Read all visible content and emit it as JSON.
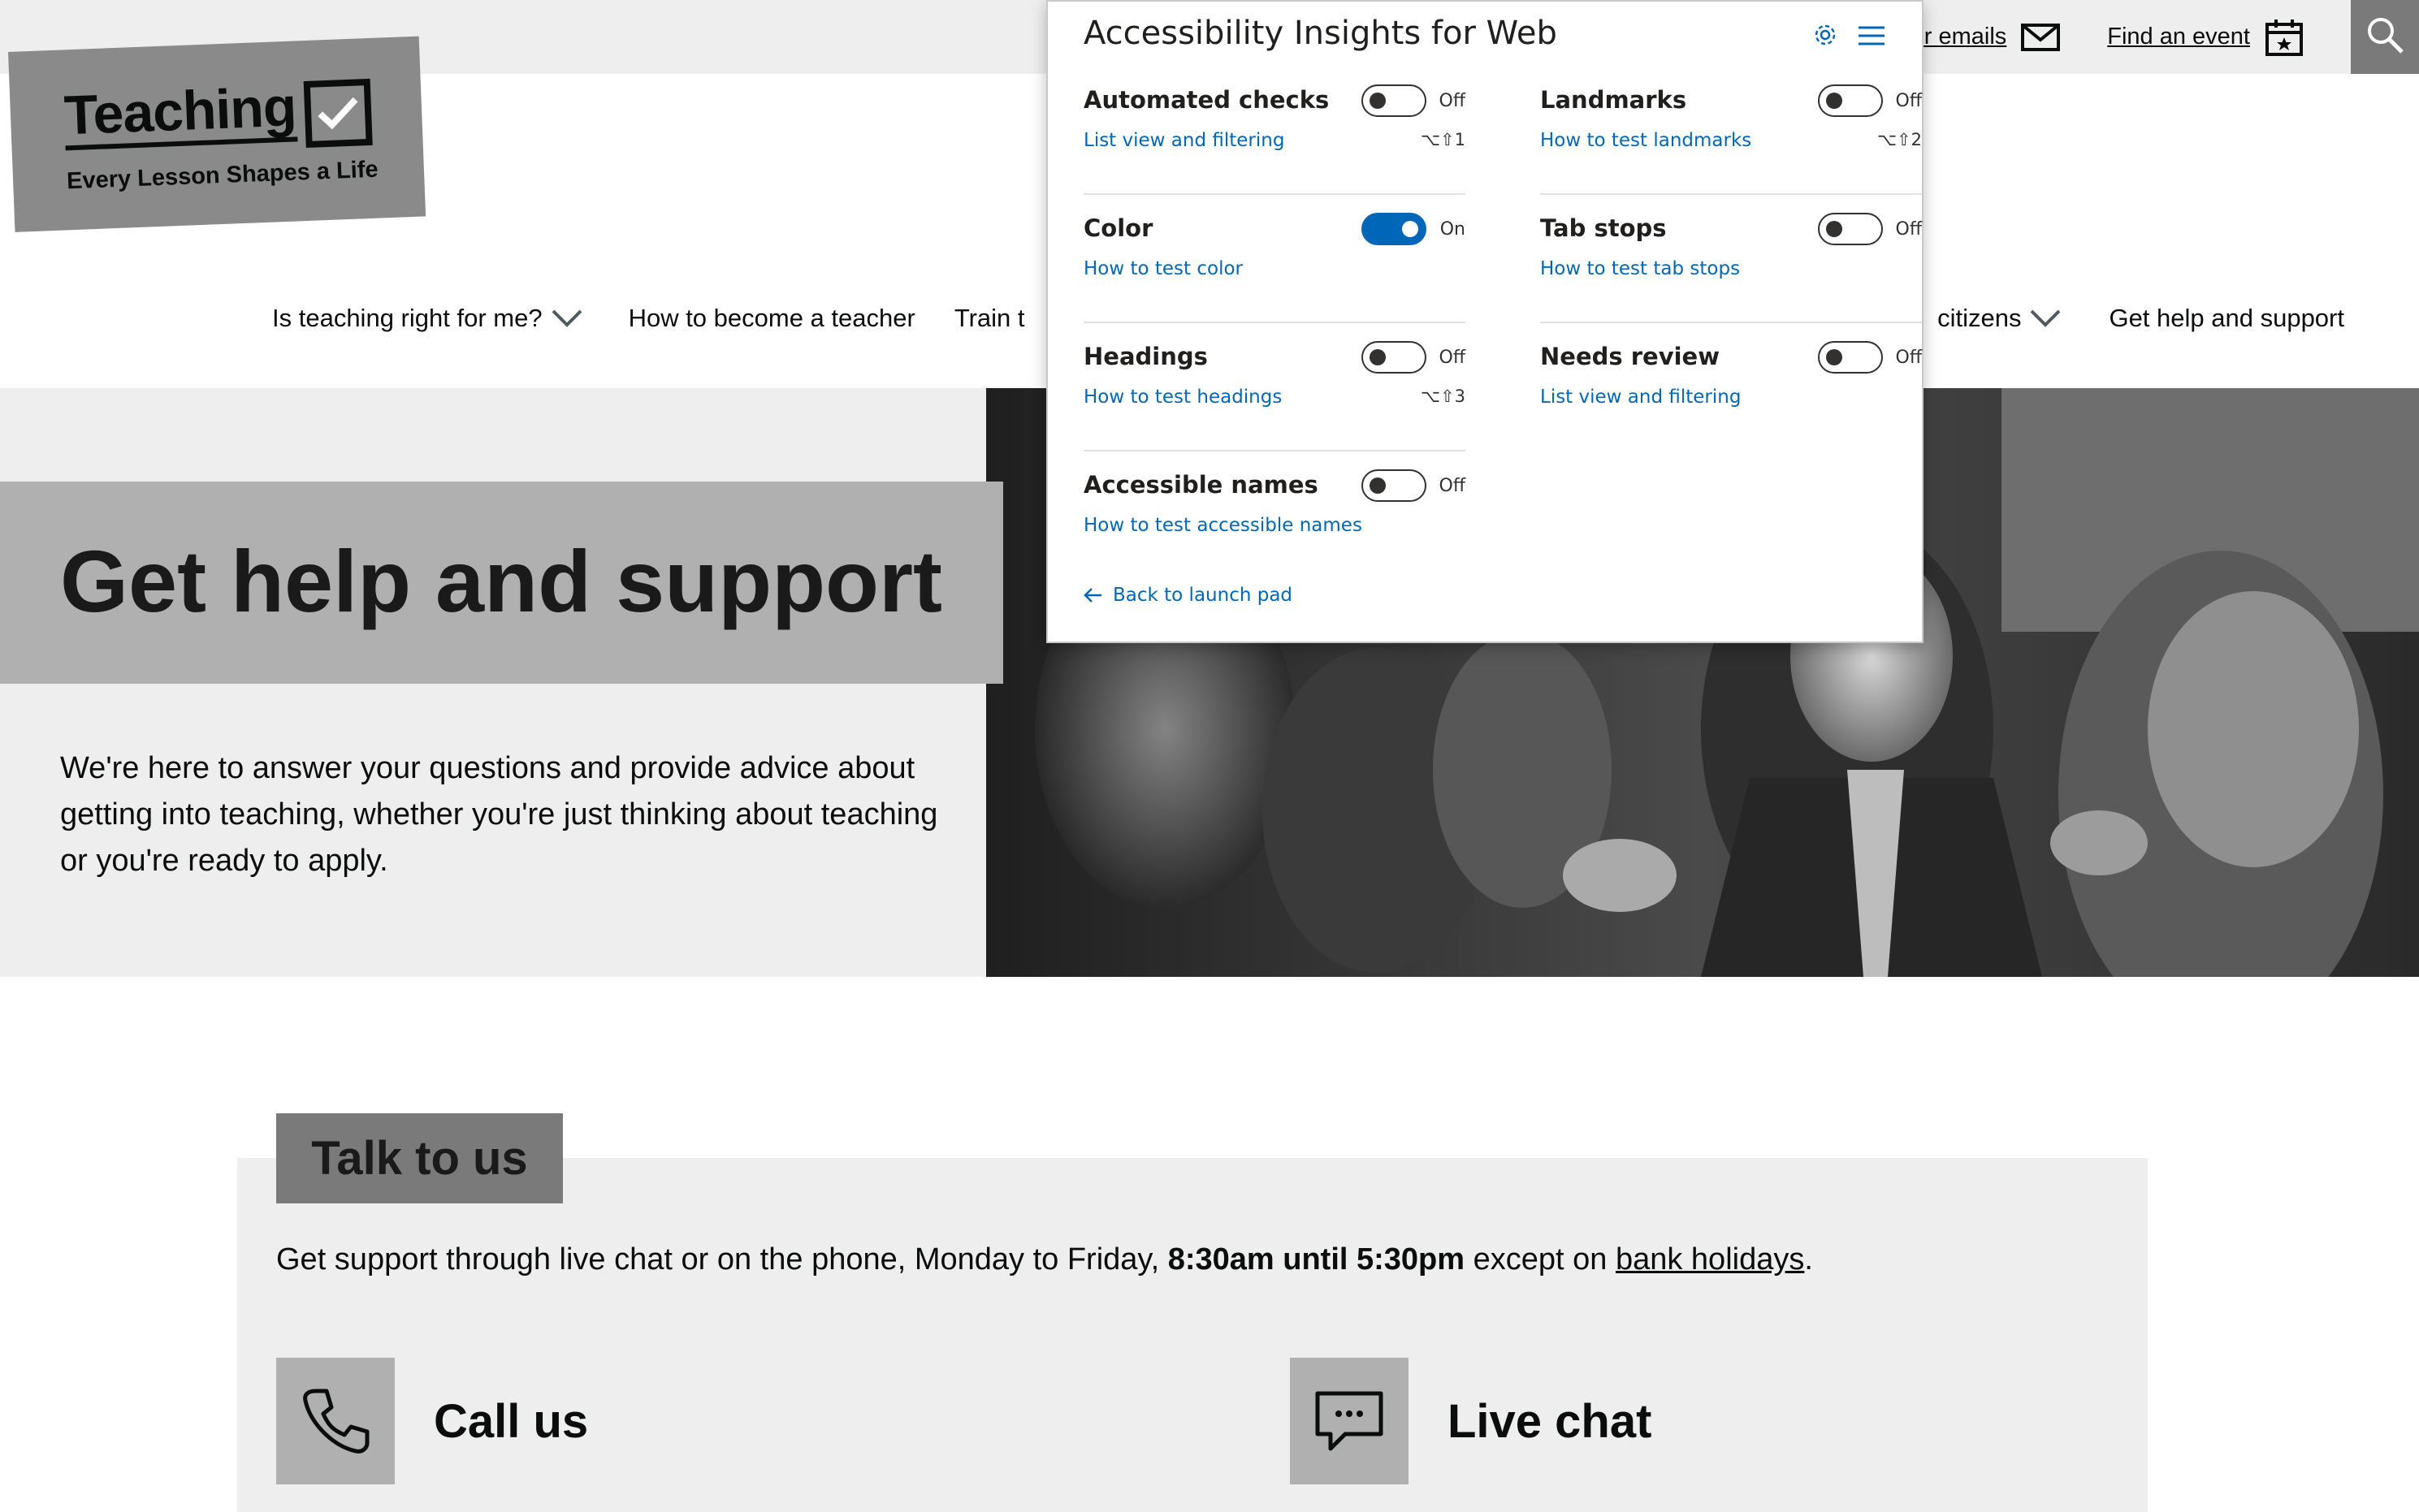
{
  "header": {
    "top_links": [
      {
        "label": "for emails",
        "icon": "envelope-icon"
      },
      {
        "label": "Find an event",
        "icon": "calendar-icon"
      }
    ],
    "search_icon": "search-icon",
    "logo": {
      "word": "Teaching",
      "tagline": "Every Lesson Shapes a Life"
    }
  },
  "nav": {
    "items": [
      {
        "label": "Is teaching right for me?",
        "has_dropdown": true
      },
      {
        "label": "How to become a teacher",
        "has_dropdown": false
      },
      {
        "label": "Train t",
        "has_dropdown": false
      }
    ],
    "right_items": [
      {
        "label": "citizens",
        "has_dropdown": true
      },
      {
        "label": "Get help and support",
        "has_dropdown": false
      }
    ]
  },
  "hero": {
    "title": "Get help and support",
    "text": "We're here to answer your questions and provide advice about getting into teaching, whether you're just thinking about teaching or you're ready to apply."
  },
  "talk": {
    "heading": "Talk to us",
    "line_start": "Get support through live chat or on the phone, Monday to Friday, ",
    "line_bold": "8:30am until 5:30pm",
    "line_mid": " except on ",
    "line_link": "bank holidays",
    "line_end": ".",
    "call_label": "Call us",
    "chat_label": "Live chat"
  },
  "ai_panel": {
    "title": "Accessibility Insights for Web",
    "accent": "#0067b8",
    "left": [
      {
        "name": "Automated checks",
        "link": "List view and filtering",
        "state": "Off",
        "on": false,
        "shortcut": "⌥⇧1"
      },
      {
        "name": "Color",
        "link": "How to test color",
        "state": "On",
        "on": true,
        "shortcut": ""
      },
      {
        "name": "Headings",
        "link": "How to test headings",
        "state": "Off",
        "on": false,
        "shortcut": "⌥⇧3"
      },
      {
        "name": "Accessible names",
        "link": "How to test accessible names",
        "state": "Off",
        "on": false,
        "shortcut": ""
      }
    ],
    "right": [
      {
        "name": "Landmarks",
        "link": "How to test landmarks",
        "state": "Off",
        "on": false,
        "shortcut": "⌥⇧2"
      },
      {
        "name": "Tab stops",
        "link": "How to test tab stops",
        "state": "Off",
        "on": false,
        "shortcut": ""
      },
      {
        "name": "Needs review",
        "link": "List view and filtering",
        "state": "Off",
        "on": false,
        "shortcut": ""
      }
    ],
    "back_label": "Back to launch pad"
  }
}
